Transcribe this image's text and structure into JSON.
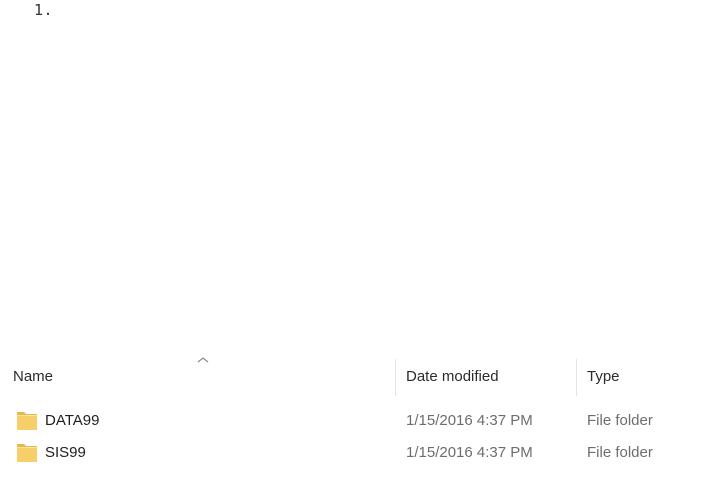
{
  "page_marker": "1.",
  "columns": {
    "name": "Name",
    "date_modified": "Date modified",
    "type": "Type"
  },
  "sort": {
    "column": "name",
    "icon": "chevron-up-icon"
  },
  "files": [
    {
      "name": "DATA99",
      "date_modified": "1/15/2016 4:37 PM",
      "type": "File folder",
      "icon": "folder-icon"
    },
    {
      "name": "SIS99",
      "date_modified": "1/15/2016 4:37 PM",
      "type": "File folder",
      "icon": "folder-icon"
    }
  ],
  "colors": {
    "folder_fill": "#f6cf6b",
    "folder_shade": "#e8b84a"
  }
}
